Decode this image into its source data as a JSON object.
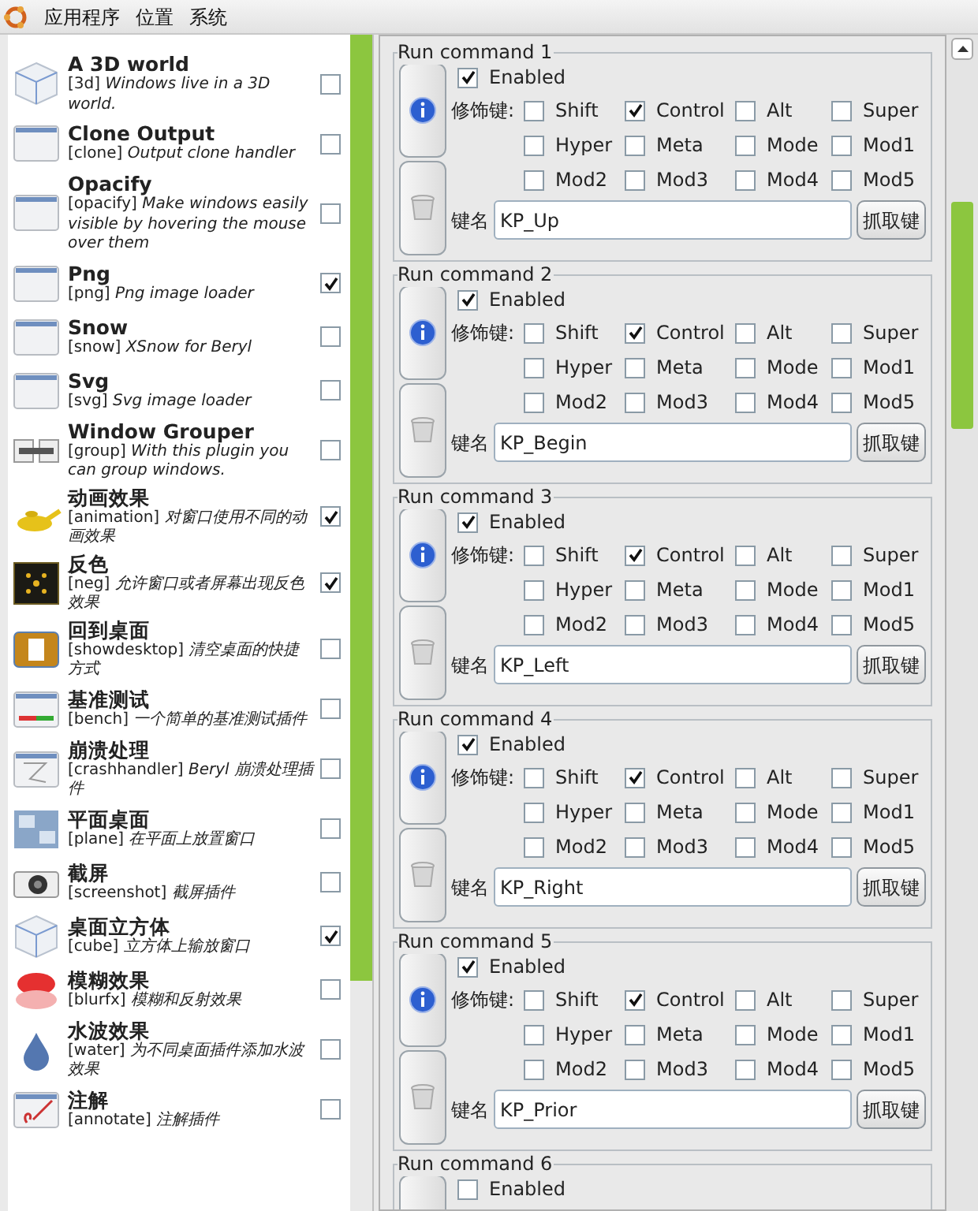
{
  "menubar": {
    "items": [
      "应用程序",
      "位置",
      "系统"
    ]
  },
  "plugins": [
    {
      "kind": "cube",
      "name": "A 3D world",
      "description": "[3d] *Windows live in a 3D world.*",
      "checked": false
    },
    {
      "kind": "window",
      "name": "Clone Output",
      "description": "[clone] *Output clone handler*",
      "checked": false
    },
    {
      "kind": "window",
      "name": "Opacify",
      "description": "[opacify] *Make windows easily visible by hovering the mouse over them*",
      "checked": false
    },
    {
      "kind": "window",
      "name": "Png",
      "description": "[png] *Png image loader*",
      "checked": true
    },
    {
      "kind": "window",
      "name": "Snow",
      "description": "[snow] *XSnow for Beryl*",
      "checked": false
    },
    {
      "kind": "window",
      "name": "Svg",
      "description": "[svg] *Svg image loader*",
      "checked": false
    },
    {
      "kind": "group",
      "name": "Window Grouper",
      "description": "[group] *With this plugin you can group windows.*",
      "checked": false
    },
    {
      "kind": "lamp",
      "name": "动画效果",
      "description": "[animation] *对窗口使用不同的动画效果*",
      "checked": true
    },
    {
      "kind": "dark",
      "name": "反色",
      "description": "[neg] *允许窗口或者屏幕出现反色效果*",
      "checked": true
    },
    {
      "kind": "desktop",
      "name": "回到桌面",
      "description": "[showdesktop] *清空桌面的快捷方式*",
      "checked": false
    },
    {
      "kind": "bench",
      "name": "基准测试",
      "description": "[bench] *一个简单的基准测试插件*",
      "checked": false
    },
    {
      "kind": "crash",
      "name": "崩溃处理",
      "description": "[crashhandler] *Beryl 崩溃处理插件*",
      "checked": false
    },
    {
      "kind": "plane",
      "name": "平面桌面",
      "description": "[plane] *在平面上放置窗口*",
      "checked": false
    },
    {
      "kind": "camera",
      "name": "截屏",
      "description": "[screenshot] *截屏插件*",
      "checked": false
    },
    {
      "kind": "cube",
      "name": "桌面立方体",
      "description": "[cube] *立方体上输放窗口*",
      "checked": true
    },
    {
      "kind": "blur",
      "name": "模糊效果",
      "description": "[blurfx] *模糊和反射效果*",
      "checked": false
    },
    {
      "kind": "drop",
      "name": "水波效果",
      "description": "[water] *为不同桌面插件添加水波效果*",
      "checked": false
    },
    {
      "kind": "annotate",
      "name": "注解",
      "description": "[annotate] *注解插件*",
      "checked": false
    }
  ],
  "commands": [
    {
      "title": "Run command 1",
      "enabled_label": "Enabled",
      "enabled": true,
      "modifier_label": "修饰键:",
      "modifiers": [
        {
          "label": "Shift",
          "checked": false
        },
        {
          "label": "Control",
          "checked": true
        },
        {
          "label": "Alt",
          "checked": false
        },
        {
          "label": "Super",
          "checked": false
        },
        {
          "label": "Hyper",
          "checked": false
        },
        {
          "label": "Meta",
          "checked": false
        },
        {
          "label": "Mode",
          "checked": false
        },
        {
          "label": "Mod1",
          "checked": false
        },
        {
          "label": "Mod2",
          "checked": false
        },
        {
          "label": "Mod3",
          "checked": false
        },
        {
          "label": "Mod4",
          "checked": false
        },
        {
          "label": "Mod5",
          "checked": false
        }
      ],
      "key_label": "键名",
      "key_value": "KP_Up",
      "grab_button": "抓取键"
    },
    {
      "title": "Run command 2",
      "enabled_label": "Enabled",
      "enabled": true,
      "modifier_label": "修饰键:",
      "modifiers": [
        {
          "label": "Shift",
          "checked": false
        },
        {
          "label": "Control",
          "checked": true
        },
        {
          "label": "Alt",
          "checked": false
        },
        {
          "label": "Super",
          "checked": false
        },
        {
          "label": "Hyper",
          "checked": false
        },
        {
          "label": "Meta",
          "checked": false
        },
        {
          "label": "Mode",
          "checked": false
        },
        {
          "label": "Mod1",
          "checked": false
        },
        {
          "label": "Mod2",
          "checked": false
        },
        {
          "label": "Mod3",
          "checked": false
        },
        {
          "label": "Mod4",
          "checked": false
        },
        {
          "label": "Mod5",
          "checked": false
        }
      ],
      "key_label": "键名",
      "key_value": "KP_Begin",
      "grab_button": "抓取键"
    },
    {
      "title": "Run command 3",
      "enabled_label": "Enabled",
      "enabled": true,
      "modifier_label": "修饰键:",
      "modifiers": [
        {
          "label": "Shift",
          "checked": false
        },
        {
          "label": "Control",
          "checked": true
        },
        {
          "label": "Alt",
          "checked": false
        },
        {
          "label": "Super",
          "checked": false
        },
        {
          "label": "Hyper",
          "checked": false
        },
        {
          "label": "Meta",
          "checked": false
        },
        {
          "label": "Mode",
          "checked": false
        },
        {
          "label": "Mod1",
          "checked": false
        },
        {
          "label": "Mod2",
          "checked": false
        },
        {
          "label": "Mod3",
          "checked": false
        },
        {
          "label": "Mod4",
          "checked": false
        },
        {
          "label": "Mod5",
          "checked": false
        }
      ],
      "key_label": "键名",
      "key_value": "KP_Left",
      "grab_button": "抓取键"
    },
    {
      "title": "Run command 4",
      "enabled_label": "Enabled",
      "enabled": true,
      "modifier_label": "修饰键:",
      "modifiers": [
        {
          "label": "Shift",
          "checked": false
        },
        {
          "label": "Control",
          "checked": true
        },
        {
          "label": "Alt",
          "checked": false
        },
        {
          "label": "Super",
          "checked": false
        },
        {
          "label": "Hyper",
          "checked": false
        },
        {
          "label": "Meta",
          "checked": false
        },
        {
          "label": "Mode",
          "checked": false
        },
        {
          "label": "Mod1",
          "checked": false
        },
        {
          "label": "Mod2",
          "checked": false
        },
        {
          "label": "Mod3",
          "checked": false
        },
        {
          "label": "Mod4",
          "checked": false
        },
        {
          "label": "Mod5",
          "checked": false
        }
      ],
      "key_label": "键名",
      "key_value": "KP_Right",
      "grab_button": "抓取键"
    },
    {
      "title": "Run command 5",
      "enabled_label": "Enabled",
      "enabled": true,
      "modifier_label": "修饰键:",
      "modifiers": [
        {
          "label": "Shift",
          "checked": false
        },
        {
          "label": "Control",
          "checked": true
        },
        {
          "label": "Alt",
          "checked": false
        },
        {
          "label": "Super",
          "checked": false
        },
        {
          "label": "Hyper",
          "checked": false
        },
        {
          "label": "Meta",
          "checked": false
        },
        {
          "label": "Mode",
          "checked": false
        },
        {
          "label": "Mod1",
          "checked": false
        },
        {
          "label": "Mod2",
          "checked": false
        },
        {
          "label": "Mod3",
          "checked": false
        },
        {
          "label": "Mod4",
          "checked": false
        },
        {
          "label": "Mod5",
          "checked": false
        }
      ],
      "key_label": "键名",
      "key_value": "KP_Prior",
      "grab_button": "抓取键"
    },
    {
      "title": "Run command 6",
      "enabled_label": "Enabled",
      "enabled": false
    }
  ]
}
